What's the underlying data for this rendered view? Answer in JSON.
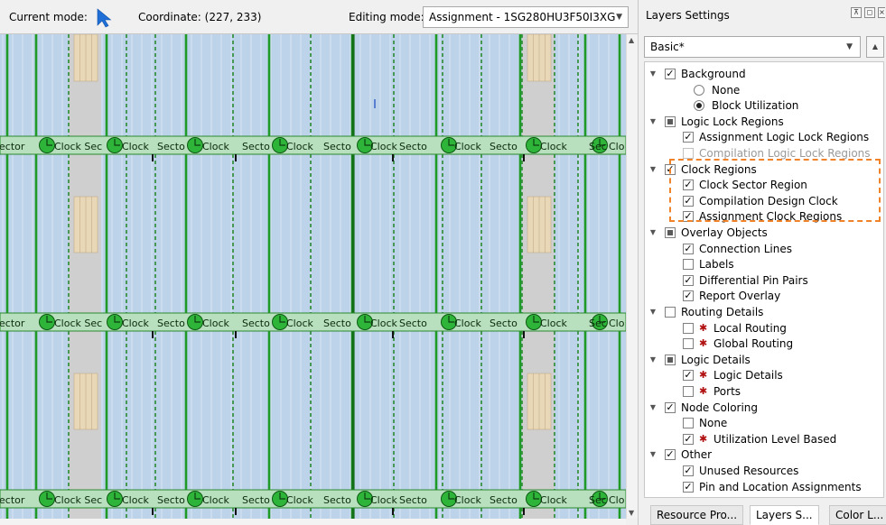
{
  "toolbar": {
    "current_mode_label": "Current mode:",
    "coordinate_text": "Coordinate: (227, 233)",
    "editing_mode_label": "Editing mode:",
    "editing_mode_value": "Assignment - 1SG280HU3F50I3XG"
  },
  "canvas": {
    "clock_band_texts": [
      "ector",
      "Clock Sec",
      "Clock",
      "Secto",
      "Clock",
      "Secto",
      "Clock",
      "Secto",
      "Clock",
      "Secto",
      "Clock",
      "Secto",
      "Clock",
      "Sec",
      "Clo"
    ],
    "colors": {
      "background": "#bcd3ea",
      "clock_region_line": "#1f9a26",
      "clock_band": "#b8e0be",
      "ram_column": "#e9d8b8"
    }
  },
  "layers_panel": {
    "title": "Layers Settings",
    "preset": "Basic*",
    "tree": [
      {
        "label": "Background",
        "expander": "open",
        "state": "checked",
        "level": 0
      },
      {
        "label": "None",
        "type": "radio",
        "state": "off",
        "level": 1
      },
      {
        "label": "Block Utilization",
        "type": "radio",
        "state": "on",
        "level": 1
      },
      {
        "label": "Logic Lock Regions",
        "expander": "open",
        "state": "partial",
        "level": 0
      },
      {
        "label": "Assignment Logic Lock Regions",
        "state": "checked",
        "level": 1
      },
      {
        "label": "Compilation Logic Lock Regions",
        "state": "disabled",
        "level": 1
      },
      {
        "label": "Clock Regions",
        "expander": "open",
        "state": "checked",
        "level": 0
      },
      {
        "label": "Clock Sector Region",
        "state": "checked",
        "level": 1
      },
      {
        "label": "Compilation Design Clock",
        "state": "checked",
        "level": 1
      },
      {
        "label": "Assignment Clock Regions",
        "state": "checked",
        "level": 1
      },
      {
        "label": "Overlay Objects",
        "expander": "open",
        "state": "partial",
        "level": 0
      },
      {
        "label": "Connection Lines",
        "state": "checked",
        "level": 1
      },
      {
        "label": "Labels",
        "state": "unchecked",
        "level": 1
      },
      {
        "label": "Differential Pin Pairs",
        "state": "checked",
        "level": 1
      },
      {
        "label": "Report Overlay",
        "state": "checked",
        "level": 1
      },
      {
        "label": "Routing Details",
        "expander": "open",
        "state": "unchecked",
        "level": 0
      },
      {
        "label": "Local Routing",
        "state": "unchecked",
        "bug": true,
        "level": 1
      },
      {
        "label": "Global Routing",
        "state": "unchecked",
        "bug": true,
        "level": 1
      },
      {
        "label": "Logic Details",
        "expander": "open",
        "state": "partial",
        "level": 0
      },
      {
        "label": "Logic Details",
        "state": "checked",
        "bug": true,
        "level": 1
      },
      {
        "label": "Ports",
        "state": "unchecked",
        "bug": true,
        "level": 1
      },
      {
        "label": "Node Coloring",
        "expander": "open",
        "state": "checked",
        "level": 0
      },
      {
        "label": "None",
        "state": "unchecked",
        "level": 1
      },
      {
        "label": "Utilization Level Based",
        "state": "checked",
        "bug": true,
        "level": 1
      },
      {
        "label": "Other",
        "expander": "open",
        "state": "checked",
        "level": 0
      },
      {
        "label": "Unused Resources",
        "state": "checked",
        "level": 1
      },
      {
        "label": "Pin and Location Assignments",
        "state": "checked",
        "level": 1
      }
    ],
    "highlight_color": "#f0822a"
  },
  "bottom_tabs": [
    {
      "label": "Resource Pro...",
      "active": false
    },
    {
      "label": "Layers S...",
      "active": true
    },
    {
      "label": "Color L...",
      "active": false
    }
  ]
}
